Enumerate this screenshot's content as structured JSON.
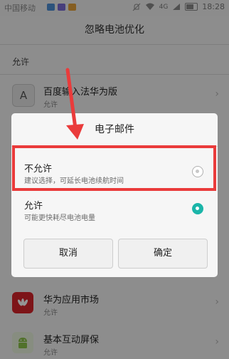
{
  "status_bar": {
    "carrier": "中国移动",
    "network": "4G",
    "time": "18:28"
  },
  "header": {
    "title": "忽略电池优化"
  },
  "section": {
    "label": "允许"
  },
  "apps": [
    {
      "name": "百度输入法华为版",
      "status": "允许",
      "icon": "baidu-input-icon",
      "icon_color": "#9a9a9a"
    },
    {
      "name": "华为应用市场",
      "status": "允许",
      "icon": "huawei-appgallery-icon",
      "icon_color": "#d8232a"
    },
    {
      "name": "基本互动屏保",
      "status": "允许",
      "icon": "android-icon",
      "icon_color": "#8cc34b"
    }
  ],
  "dialog": {
    "title": "电子邮件",
    "options": [
      {
        "title": "不允许",
        "subtitle": "建议选择，可延长电池续航时间",
        "selected": false
      },
      {
        "title": "允许",
        "subtitle": "可能更快耗尽电池电量",
        "selected": true
      }
    ],
    "cancel_label": "取消",
    "confirm_label": "确定"
  },
  "colors": {
    "accent": "#1bb5a9",
    "annotation": "#ea3b3b"
  }
}
